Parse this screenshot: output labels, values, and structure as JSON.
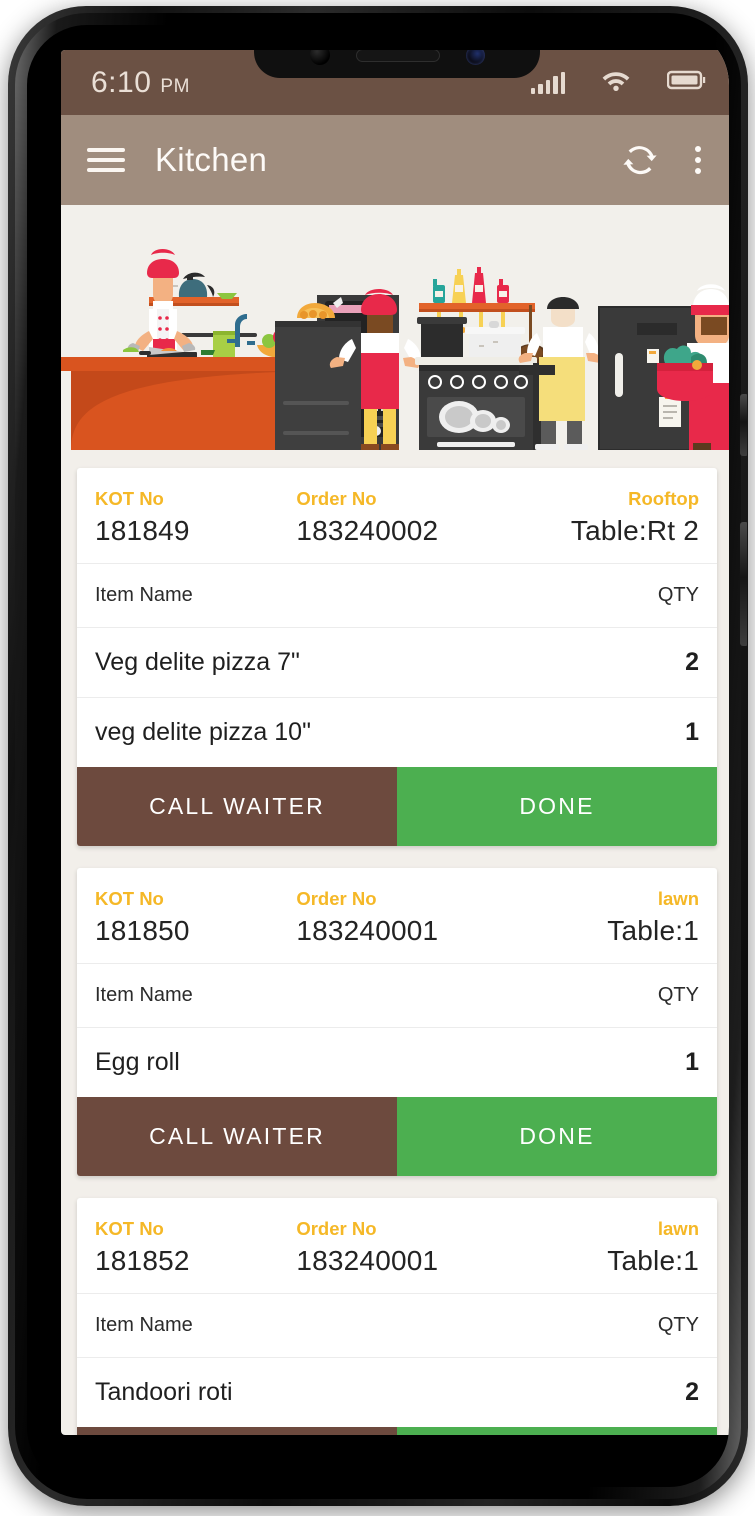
{
  "status_bar": {
    "time": "6:10",
    "ampm": "PM",
    "signal_icon": "signal-bars-icon",
    "wifi_icon": "wifi-icon",
    "battery_icon": "battery-full-icon"
  },
  "app_bar": {
    "menu_icon": "hamburger-menu-icon",
    "title": "Kitchen",
    "refresh_icon": "refresh-sync-icon",
    "overflow_icon": "more-vertical-icon"
  },
  "banner": {
    "name": "kitchen-illustration",
    "background": "#F2F0EB"
  },
  "colors": {
    "status_bar": "#6B5144",
    "app_bar": "#A08D7E",
    "page_background": "#F2EFEA",
    "card": "#FFFFFF",
    "label_amber": "#F5B827",
    "call_waiter": "#6D4A3E",
    "done": "#4CAF50"
  },
  "table_headers": {
    "item_name": "Item Name",
    "qty": "QTY"
  },
  "labels": {
    "kot_no": "KOT No",
    "order_no": "Order No",
    "call_waiter": "CALL WAITER",
    "done": "DONE"
  },
  "orders": [
    {
      "kot_label": "KOT No",
      "kot_no": "181849",
      "order_label": "Order No",
      "order_no": "183240002",
      "area_label": "Rooftop",
      "table": "Table:Rt 2",
      "items": [
        {
          "name": "Veg delite pizza 7\"",
          "qty": "2"
        },
        {
          "name": "veg delite pizza 10\"",
          "qty": "1"
        }
      ]
    },
    {
      "kot_label": "KOT No",
      "kot_no": "181850",
      "order_label": "Order No",
      "order_no": "183240001",
      "area_label": "lawn",
      "table": "Table:1",
      "items": [
        {
          "name": "Egg roll",
          "qty": "1"
        }
      ]
    },
    {
      "kot_label": "KOT No",
      "kot_no": "181852",
      "order_label": "Order No",
      "order_no": "183240001",
      "area_label": "lawn",
      "table": "Table:1",
      "items": [
        {
          "name": "Tandoori roti",
          "qty": "2"
        }
      ]
    }
  ]
}
